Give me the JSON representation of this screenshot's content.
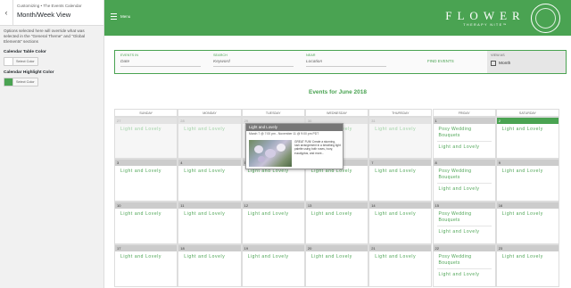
{
  "sidebar": {
    "breadcrumb": "Customizing • The Events Calendar",
    "title": "Month/Week View",
    "description": "Options selected here will override what was selected in the \"General Theme\" and \"Global Elements\" sections",
    "table_color": {
      "label": "Calendar Table Color",
      "button": "Select Color",
      "swatch": "#ffffff"
    },
    "highlight_color": {
      "label": "Calendar Highlight Color",
      "button": "Select Color",
      "swatch": "#4aa352"
    },
    "hide_controls": ""
  },
  "header": {
    "menu_label": "Menu",
    "logo_main": "FLOWER",
    "logo_sub": "THERAPY NITE™",
    "background": "#4aa352"
  },
  "filters": {
    "events_in_label": "EVENTS IN",
    "events_in_value": "Date",
    "search_label": "SEARCH",
    "search_value": "Keyword",
    "near_label": "NEAR",
    "near_value": "Location",
    "find_button": "FIND EVENTS",
    "view_label": "VIEW AS",
    "view_value": "Month"
  },
  "calendar": {
    "title": "Events for June 2018",
    "days": [
      "SUNDAY",
      "MONDAY",
      "TUESDAY",
      "WEDNESDAY",
      "THURSDAY",
      "FRIDAY",
      "SATURDAY"
    ],
    "event_name": "Light and Lovely",
    "posy_name": "Posy Wedding Bouquets",
    "weeks": [
      [
        "27",
        "28",
        "29",
        "30",
        "31",
        "1",
        "2"
      ],
      [
        "3",
        "4",
        "5",
        "6",
        "7",
        "8",
        "9"
      ],
      [
        "10",
        "11",
        "12",
        "13",
        "14",
        "15",
        "16"
      ],
      [
        "17",
        "18",
        "19",
        "20",
        "21",
        "22",
        "23"
      ]
    ]
  },
  "tooltip": {
    "title": "Light and Lovely",
    "date": "March 7 @ 7:00 pm - November 11 @ 9:00 pm PDT",
    "text": "GREAT FUN! Create a stunning, lush arrangement in a breathing light palette using both roses, ivory, eucalyptus, and more..."
  }
}
